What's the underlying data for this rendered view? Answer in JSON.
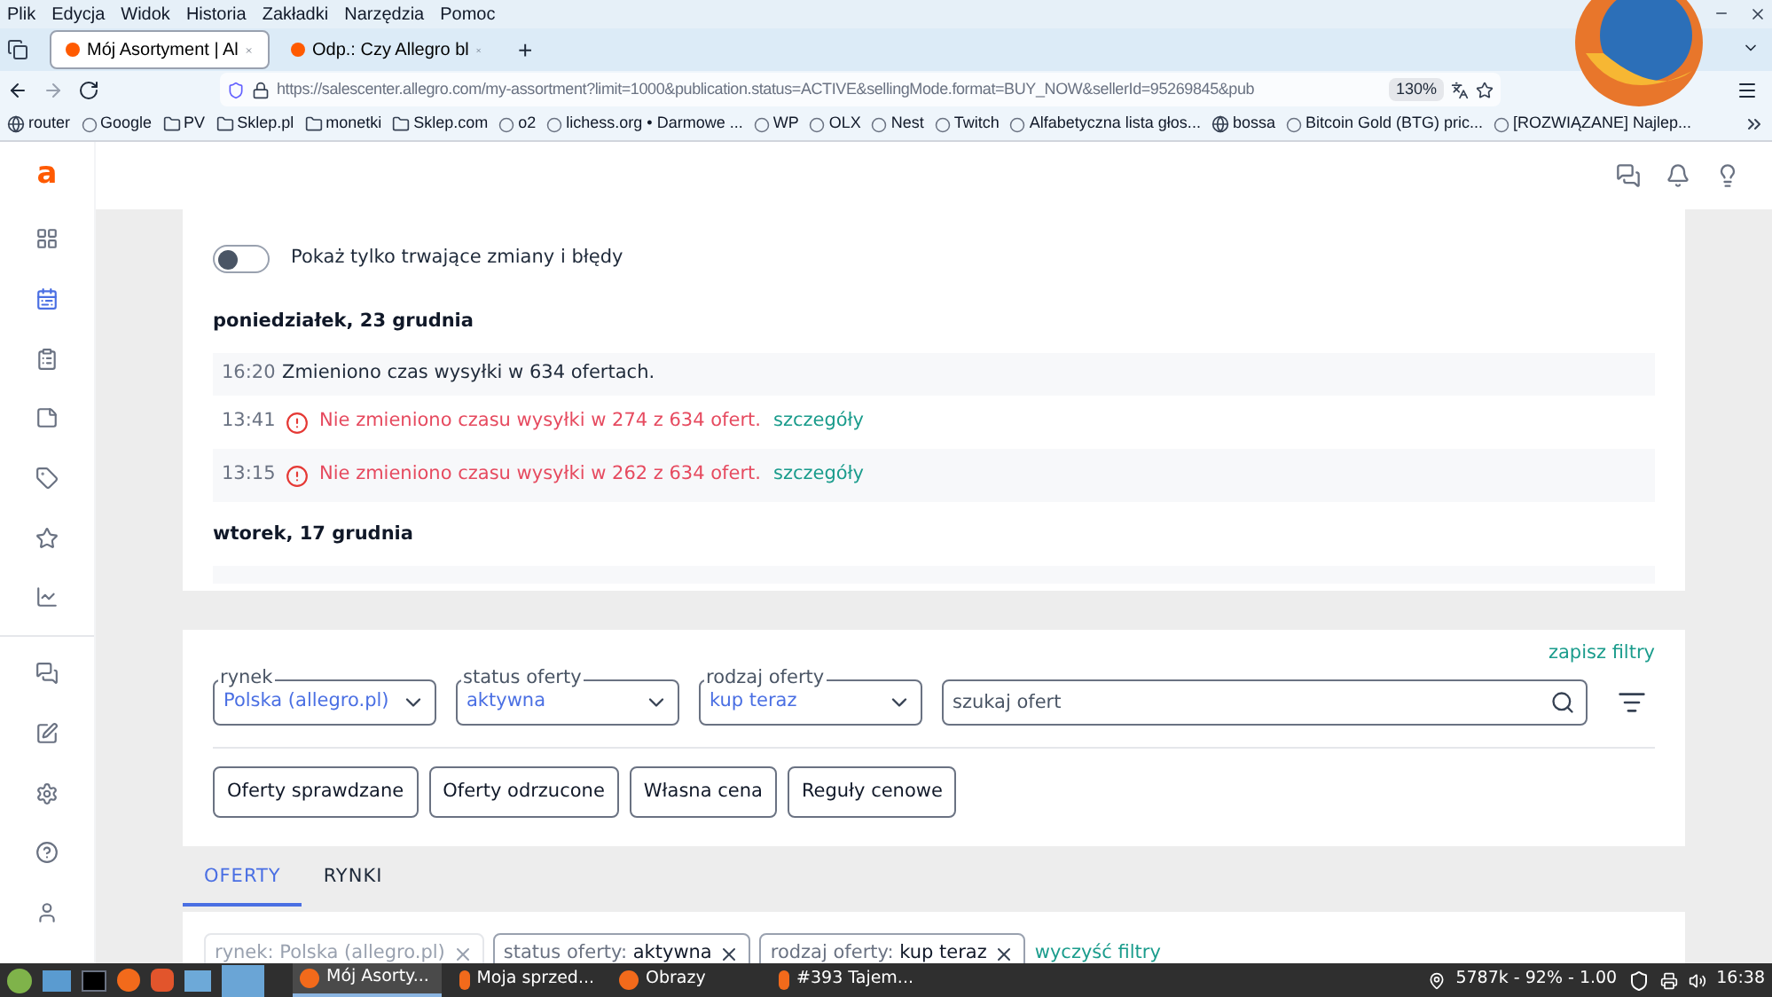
{
  "menu": [
    "Plik",
    "Edycja",
    "Widok",
    "Historia",
    "Zakładki",
    "Narzędzia",
    "Pomoc"
  ],
  "browser_tabs": [
    {
      "title": "Mój Asortyment | Al",
      "selected": true
    },
    {
      "title": "Odp.: Czy Allegro bl",
      "selected": false
    }
  ],
  "new_tab": "+",
  "address": {
    "url": "https://salescenter.allegro.com/my-assortment?limit=1000&publication.status=ACTIVE&sellingMode.format=BUY_NOW&sellerId=95269845&pub",
    "zoom": "130%"
  },
  "bookmarks": [
    {
      "label": "router",
      "kind": "globe"
    },
    {
      "label": "Google",
      "kind": "site"
    },
    {
      "label": "PV",
      "kind": "folder"
    },
    {
      "label": "Sklep.pl",
      "kind": "folder"
    },
    {
      "label": "monetki",
      "kind": "folder"
    },
    {
      "label": "Sklep.com",
      "kind": "folder"
    },
    {
      "label": "o2",
      "kind": "site"
    },
    {
      "label": "lichess.org • Darmowe ...",
      "kind": "site"
    },
    {
      "label": "WP",
      "kind": "site"
    },
    {
      "label": "OLX",
      "kind": "site"
    },
    {
      "label": "Nest",
      "kind": "site"
    },
    {
      "label": "Twitch",
      "kind": "site"
    },
    {
      "label": "Alfabetyczna lista głos...",
      "kind": "site"
    },
    {
      "label": "bossa",
      "kind": "globe"
    },
    {
      "label": "Bitcoin Gold (BTG) pric...",
      "kind": "site"
    },
    {
      "label": "[ROZWIĄZANE] Najlep...",
      "kind": "site"
    }
  ],
  "app": {
    "logo": "a",
    "sidebar": [
      {
        "kind": "grid",
        "selected": false
      },
      {
        "kind": "calendar",
        "selected": true
      },
      {
        "kind": "clipboard",
        "selected": false
      },
      {
        "kind": "note",
        "selected": false
      },
      {
        "kind": "tag",
        "selected": false
      },
      {
        "kind": "star",
        "selected": false
      },
      {
        "kind": "chart",
        "selected": false
      },
      {
        "kind": "chat",
        "selected": false
      },
      {
        "kind": "edit",
        "selected": false
      },
      {
        "kind": "settings",
        "selected": false
      },
      {
        "kind": "help",
        "selected": false
      },
      {
        "kind": "user",
        "selected": false
      }
    ],
    "changes": {
      "toggle": {
        "label": "Pokaż tylko trwające zmiany i błędy",
        "on": false
      },
      "days": [
        {
          "date": "poniedziałek, 23 grudnia",
          "entries": [
            {
              "time": "16:20",
              "text": "Zmieniono czas wysyłki w 634 ofertach.",
              "kind": "info"
            },
            {
              "time": "13:41",
              "text": "Nie zmieniono czasu wysyłki w 274 z 634 ofert.",
              "kind": "error",
              "link": "szczegóły"
            },
            {
              "time": "13:15",
              "text": "Nie zmieniono czasu wysyłki w 262 z 634 ofert.",
              "kind": "error",
              "link": "szczegóły"
            }
          ]
        },
        {
          "date": "wtorek, 17 grudnia"
        }
      ]
    },
    "filters": {
      "save": "zapisz filtry",
      "selects": [
        {
          "label": "rynek",
          "value": "Polska (allegro.pl)"
        },
        {
          "label": "status oferty",
          "value": "aktywna"
        },
        {
          "label": "rodzaj oferty",
          "value": "kup teraz"
        }
      ],
      "search": {
        "placeholder": "szukaj ofert"
      },
      "buttons": [
        "Oferty sprawdzane",
        "Oferty odrzucone",
        "Własna cena",
        "Reguły cenowe"
      ]
    },
    "tabs": [
      {
        "label": "OFERTY",
        "selected": true
      },
      {
        "label": "RYNKI",
        "selected": false
      }
    ],
    "chips": [
      {
        "label": "rynek:",
        "value": "Polska (allegro.pl)",
        "disabled": true
      },
      {
        "label": "status oferty:",
        "value": "aktywna",
        "disabled": false
      },
      {
        "label": "rodzaj oferty:",
        "value": "kup teraz",
        "disabled": false
      }
    ],
    "clear": "wyczyść filtry"
  },
  "taskbar": {
    "windows": [
      {
        "label": "Mój Asorty...",
        "selected": true
      },
      {
        "label": "Moja sprzed...",
        "selected": false
      },
      {
        "label": "Obrazy",
        "selected": false
      },
      {
        "label": "#393 Tajem...",
        "selected": false
      }
    ],
    "status": "5787k - 92% - 1.00",
    "clock": "16:38"
  }
}
